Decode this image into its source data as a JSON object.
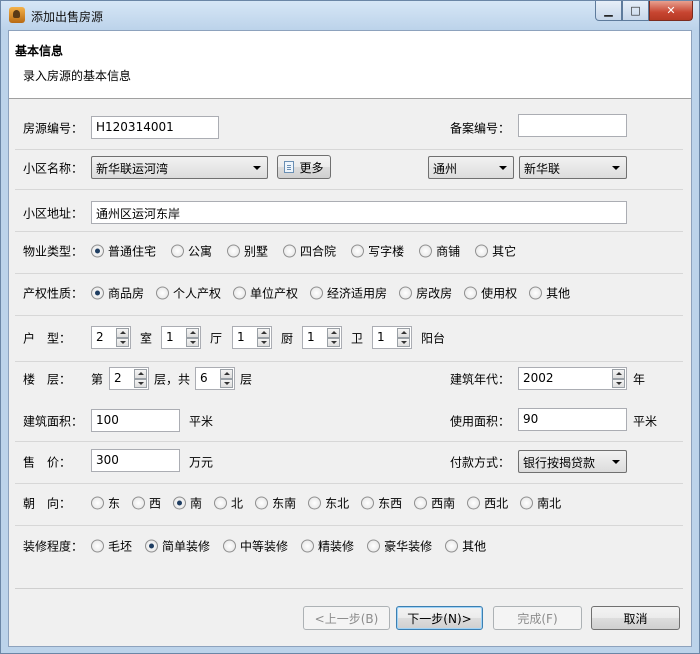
{
  "window": {
    "title": "添加出售房源",
    "minimize": "▁",
    "maximize": "□",
    "close": "✕"
  },
  "header": {
    "title": "基本信息",
    "subtitle": "录入房源的基本信息"
  },
  "fields": {
    "house_no": {
      "label": "房源编号：",
      "value": "H120314001"
    },
    "record_no": {
      "label": "备案编号：",
      "value": ""
    },
    "community": {
      "label": "小区名称：",
      "value": "新华联运河湾",
      "more_button": "更多",
      "district": "通州",
      "area": "新华联"
    },
    "address": {
      "label": "小区地址：",
      "value": "通州区运河东岸"
    },
    "property_type": {
      "label": "物业类型：",
      "options": [
        "普通住宅",
        "公寓",
        "别墅",
        "四合院",
        "写字楼",
        "商铺",
        "其它"
      ],
      "selected": "普通住宅"
    },
    "ownership": {
      "label": "产权性质：",
      "options": [
        "商品房",
        "个人产权",
        "单位产权",
        "经济适用房",
        "房改房",
        "使用权",
        "其他"
      ],
      "selected": "商品房"
    },
    "layout": {
      "label": "户　型：",
      "rooms": "2",
      "rooms_unit": "室",
      "halls": "1",
      "halls_unit": "厅",
      "kitchens": "1",
      "kitchens_unit": "厨",
      "baths": "1",
      "baths_unit": "卫",
      "balconies": "1",
      "balconies_unit": "阳台"
    },
    "floor": {
      "label": "楼　层：",
      "prefix": "第",
      "floor": "2",
      "mid": "层，共",
      "total": "6",
      "suffix": "层"
    },
    "build_year": {
      "label": "建筑年代：",
      "value": "2002",
      "unit": "年"
    },
    "build_area": {
      "label": "建筑面积：",
      "value": "100",
      "unit": "平米"
    },
    "use_area": {
      "label": "使用面积：",
      "value": "90",
      "unit": "平米"
    },
    "price": {
      "label": "售　价：",
      "value": "300",
      "unit": "万元"
    },
    "payment": {
      "label": "付款方式：",
      "value": "银行按揭贷款"
    },
    "orientation": {
      "label": "朝　向：",
      "options": [
        "东",
        "西",
        "南",
        "北",
        "东南",
        "东北",
        "东西",
        "西南",
        "西北",
        "南北"
      ],
      "selected": "南"
    },
    "decoration": {
      "label": "装修程度：",
      "options": [
        "毛坯",
        "简单装修",
        "中等装修",
        "精装修",
        "豪华装修",
        "其他"
      ],
      "selected": "简单装修"
    }
  },
  "buttons": {
    "prev": "<上一步(B)",
    "next": "下一步(N)>",
    "finish": "完成(F)",
    "cancel": "取消"
  }
}
